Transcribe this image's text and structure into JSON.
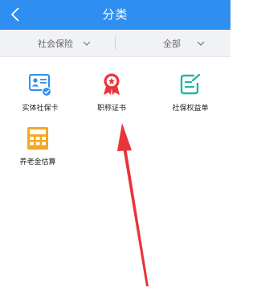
{
  "header": {
    "title": "分类",
    "background_color": "#2f8ff0",
    "back_icon": "back-chevron-icon"
  },
  "filters": {
    "left": {
      "value": "社会保险",
      "icon": "chevron-down-icon"
    },
    "right": {
      "value": "全部",
      "icon": "chevron-down-icon"
    }
  },
  "items": [
    {
      "label": "实体社保卡",
      "icon": "id-card-check-icon",
      "color": "#2f8ff0"
    },
    {
      "label": "职称证书",
      "icon": "award-ribbon-icon",
      "color": "#e8343a"
    },
    {
      "label": "社保权益单",
      "icon": "edit-document-icon",
      "color": "#21b89f"
    },
    {
      "label": "养老金估算",
      "icon": "calculator-icon",
      "color": "#f5a623"
    }
  ],
  "annotation": {
    "type": "red-arrow",
    "color": "#e8343a",
    "points_to": "职称证书"
  }
}
